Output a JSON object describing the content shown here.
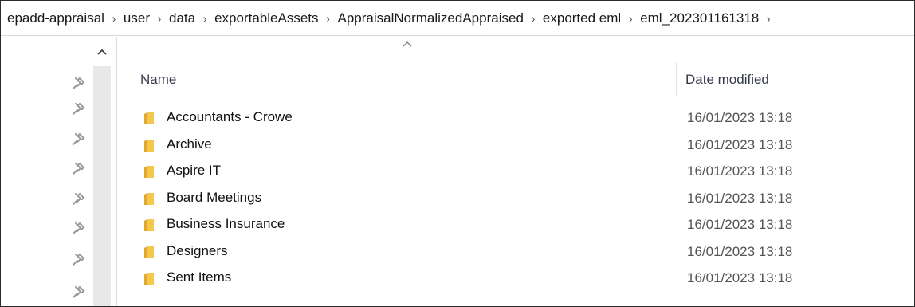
{
  "breadcrumb": [
    "epadd-appraisal",
    "user",
    "data",
    "exportableAssets",
    "AppraisalNormalizedAppraised",
    "exported eml",
    "eml_202301161318"
  ],
  "breadcrumb_separator": "›",
  "columns": {
    "name": "Name",
    "date_modified": "Date modified"
  },
  "folders": [
    {
      "name": "Accountants - Crowe",
      "date": "16/01/2023 13:18"
    },
    {
      "name": "Archive",
      "date": "16/01/2023 13:18"
    },
    {
      "name": "Aspire IT",
      "date": "16/01/2023 13:18"
    },
    {
      "name": "Board Meetings",
      "date": "16/01/2023 13:18"
    },
    {
      "name": "Business Insurance",
      "date": "16/01/2023 13:18"
    },
    {
      "name": "Designers",
      "date": "16/01/2023 13:18"
    },
    {
      "name": "Sent Items",
      "date": "16/01/2023 13:18"
    }
  ],
  "icons": {
    "pin": "pin-icon",
    "folder": "folder-icon",
    "sort": "sort-ascending-icon",
    "scroll_up": "chevron-up-icon"
  },
  "colors": {
    "folder": "#f4c84c",
    "folder_dark": "#e0a82e",
    "scroll_track": "#e8e8e8"
  }
}
